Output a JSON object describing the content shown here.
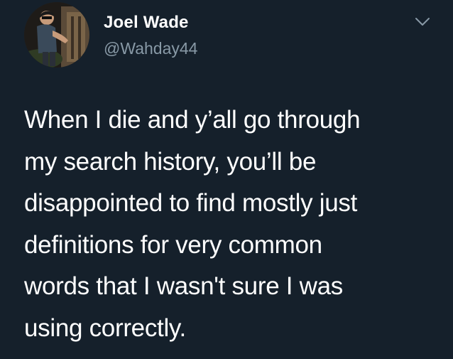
{
  "author": {
    "display_name": "Joel Wade",
    "handle": "@Wahday44"
  },
  "icons": {
    "avatar": "user-photo",
    "menu": "chevron-down-icon"
  },
  "tweet": {
    "lines": [
      "When I die and y’all go through",
      "my search history, you’ll be",
      "disappointed to find mostly just",
      "definitions for very common",
      "words that I wasn't sure I was",
      "using correctly."
    ]
  },
  "colors": {
    "background": "#15202b",
    "text": "#ffffff",
    "secondary_text": "#8899a6"
  }
}
